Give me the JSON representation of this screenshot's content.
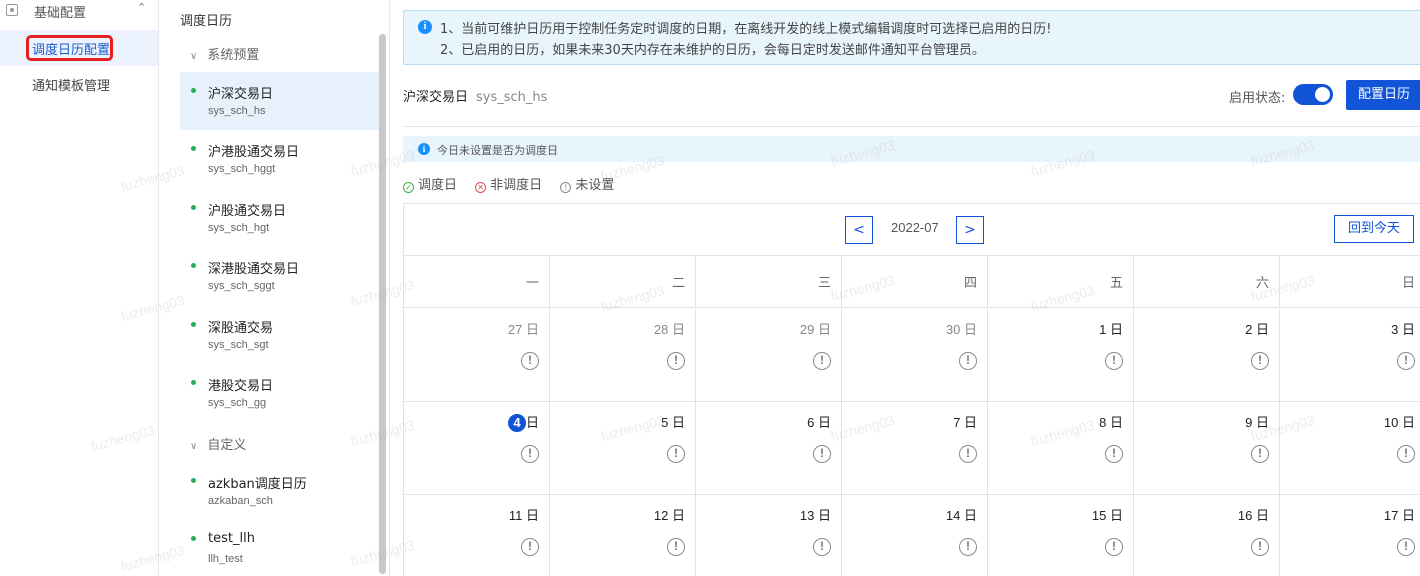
{
  "nav": {
    "group_label": "基础配置",
    "items": [
      {
        "label": "调度日历配置",
        "active": true
      },
      {
        "label": "通知模板管理",
        "active": false
      }
    ]
  },
  "list": {
    "title": "调度日历",
    "sections": [
      {
        "label": "系统预置",
        "items": [
          {
            "name": "沪深交易日",
            "code": "sys_sch_hs",
            "active": true
          },
          {
            "name": "沪港股通交易日",
            "code": "sys_sch_hggt"
          },
          {
            "name": "沪股通交易日",
            "code": "sys_sch_hgt"
          },
          {
            "name": "深港股通交易日",
            "code": "sys_sch_sggt"
          },
          {
            "name": "深股通交易",
            "code": "sys_sch_sgt"
          },
          {
            "name": "港股交易日",
            "code": "sys_sch_gg"
          }
        ]
      },
      {
        "label": "自定义",
        "items": [
          {
            "name": "azkban调度日历",
            "code": "azkaban_sch"
          },
          {
            "name": "test_llh",
            "code": "llh_test"
          }
        ]
      }
    ]
  },
  "main": {
    "notice_line1": "1、当前可维护日历用于控制任务定时调度的日期，在离线开发的线上模式编辑调度时可选择已启用的日历!",
    "notice_line2": "2、已启用的日历，如果未来30天内存在未维护的日历，会每日定时发送邮件通知平台管理员。",
    "calendar_name": "沪深交易日",
    "calendar_code": "sys_sch_hs",
    "status_label": "启用状态:",
    "enabled": true,
    "config_button": "配置日历",
    "today_notice": "今日未设置是否为调度日",
    "legend": [
      {
        "icon": "✓",
        "label": "调度日",
        "kind": "ok"
      },
      {
        "icon": "✕",
        "label": "非调度日",
        "kind": "no"
      },
      {
        "icon": "!",
        "label": "未设置",
        "kind": "un"
      }
    ],
    "month": "2022-07",
    "prev_glyph": "<",
    "next_glyph": ">",
    "today_button": "回到今天",
    "weekdays": [
      "一",
      "二",
      "三",
      "四",
      "五",
      "六",
      "日"
    ],
    "day_suffix": "日",
    "today": 4,
    "weeks": [
      [
        {
          "d": 27,
          "other": true
        },
        {
          "d": 28,
          "other": true
        },
        {
          "d": 29,
          "other": true
        },
        {
          "d": 30,
          "other": true
        },
        {
          "d": 1
        },
        {
          "d": 2
        },
        {
          "d": 3
        }
      ],
      [
        {
          "d": 4
        },
        {
          "d": 5
        },
        {
          "d": 6
        },
        {
          "d": 7
        },
        {
          "d": 8
        },
        {
          "d": 9
        },
        {
          "d": 10
        }
      ],
      [
        {
          "d": 11
        },
        {
          "d": 12
        },
        {
          "d": 13
        },
        {
          "d": 14
        },
        {
          "d": 15
        },
        {
          "d": 16
        },
        {
          "d": 17
        }
      ]
    ],
    "unset_glyph": "!",
    "watermark": "fuzheng03"
  },
  "colors": {
    "primary": "#1254d8",
    "active_bg": "#e7f1fc",
    "dot": "#27ae60",
    "highlight": "#e51d1d"
  }
}
